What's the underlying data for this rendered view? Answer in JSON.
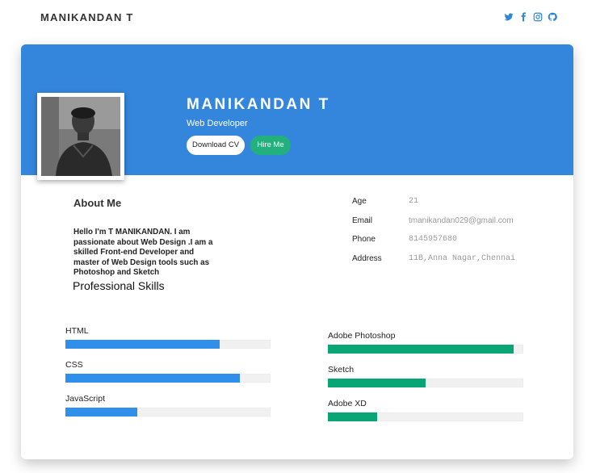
{
  "brand": "MANIKANDAN T",
  "social": [
    {
      "icon": "twitter-icon"
    },
    {
      "icon": "facebook-icon"
    },
    {
      "icon": "instagram-icon"
    },
    {
      "icon": "github-icon"
    }
  ],
  "hero": {
    "name": "MANIKANDAN T",
    "role": "Web Developer",
    "download_label": "Download CV",
    "hire_label": "Hire Me"
  },
  "about": {
    "title": "About Me",
    "text": "Hello I'm T MANIKANDAN. I am passionate about Web Design .I am a skilled Front-end Developer and master of Web Design tools such as Photoshop and Sketch"
  },
  "info": [
    {
      "label": "Age",
      "value": "21"
    },
    {
      "label": "Email",
      "value": "tmanikandan029@gmail.com"
    },
    {
      "label": "Phone",
      "value": "8145957680"
    },
    {
      "label": "Address",
      "value": "11B,Anna Nagar,Chennai"
    }
  ],
  "skills": {
    "title": "Professional Skills",
    "left": [
      {
        "name": "HTML",
        "level": 0.75
      },
      {
        "name": "CSS",
        "level": 0.85
      },
      {
        "name": "JavaScript",
        "level": 0.35
      }
    ],
    "right": [
      {
        "name": "Adobe Photoshop",
        "level": 0.95
      },
      {
        "name": "Sketch",
        "level": 0.5
      },
      {
        "name": "Adobe XD",
        "level": 0.25
      }
    ]
  },
  "colors": {
    "banner": "#3486dc",
    "accent_blue": "#2f8fea",
    "accent_green": "#0aa574",
    "hire_button": "#22b07d",
    "icon_blue": "#2f86d8"
  }
}
